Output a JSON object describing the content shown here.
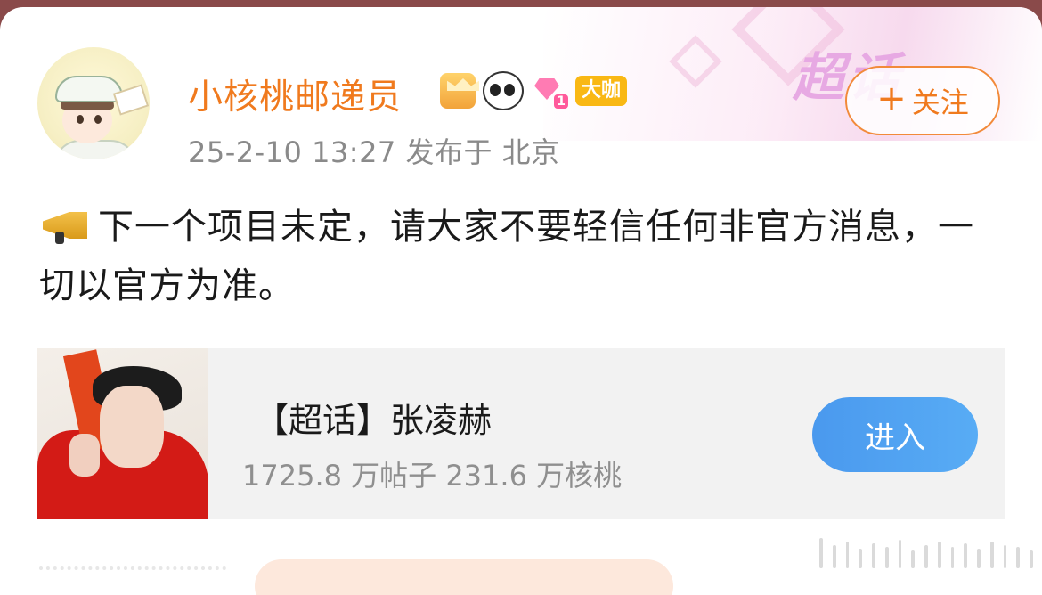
{
  "user": {
    "name": "小核桃邮递员",
    "badges": [
      "crown-badge",
      "panda-badge",
      "gem-badge",
      "大咖"
    ],
    "gem_level": "1",
    "timestamp": "25-2-10 13:27",
    "published_prefix": "发布于",
    "location": "北京",
    "meta": "25-2-10 13:27  发布于 北京"
  },
  "follow_button": {
    "plus": "+",
    "label": "关注"
  },
  "header_deco": {
    "word": "超话"
  },
  "post": {
    "icon": "megaphone-icon",
    "text": "下一个项目未定，请大家不要轻信任何非官方消息，一切以官方为准。"
  },
  "topic_card": {
    "title": "【超话】张凌赫",
    "stats": "1725.8 万帖子 231.6 万核桃",
    "enter_label": "进入"
  },
  "colors": {
    "name": "#f07a1e",
    "follow_border": "#f28a3a",
    "enter_button": "#4a99ee",
    "daka_badge": "#f9b814"
  }
}
